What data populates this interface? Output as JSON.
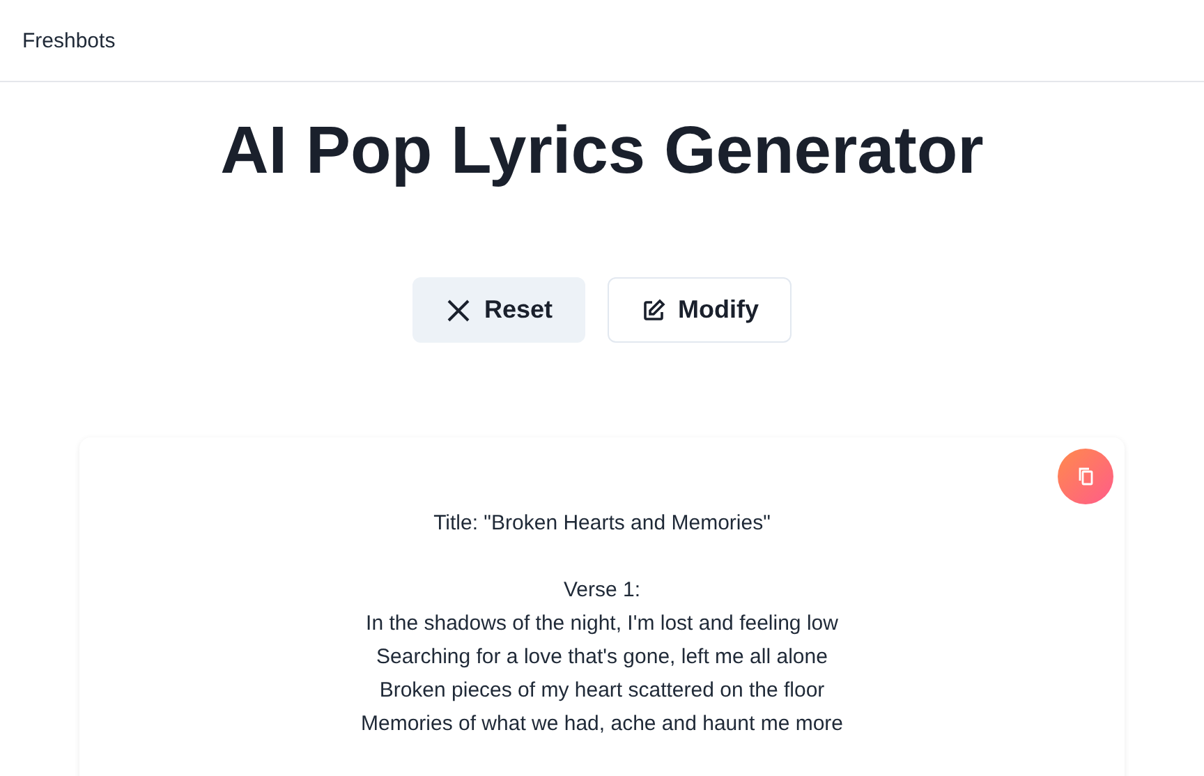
{
  "brand": "Freshbots",
  "heading": "AI Pop Lyrics Generator",
  "buttons": [
    {
      "kind": "reset",
      "label": "Reset"
    },
    {
      "kind": "modify",
      "label": "Modify"
    }
  ],
  "lyrics": [
    {
      "lines": [
        "Title: \"Broken Hearts and Memories\""
      ]
    },
    {
      "lines": [
        "Verse 1:",
        "In the shadows of the night, I'm lost and feeling low",
        "Searching for a love that's gone, left me all alone",
        "Broken pieces of my heart scattered on the floor",
        "Memories of what we had, ache and haunt me more"
      ]
    }
  ]
}
